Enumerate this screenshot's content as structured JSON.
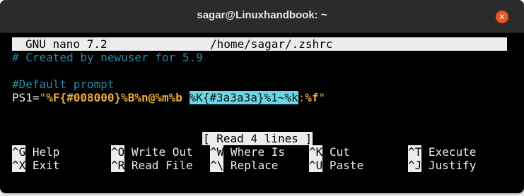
{
  "window": {
    "title": "sagar@Linuxhandbook: ~",
    "close_glyph": "✕",
    "accent": "#e9541f"
  },
  "nano": {
    "version": "GNU nano 7.2",
    "file": "/home/sagar/.zshrc"
  },
  "editor": {
    "line1": "# Created by newuser for 5.9",
    "line3": "#Default prompt",
    "line4": {
      "var": "PS1",
      "eq": "=",
      "quote_open": "\"",
      "segA": "%F{#008000}",
      "segB": "%B",
      "segC": "%n@%m",
      "segD": "%b ",
      "segE": "%K{#3a3a3a}",
      "segF": "%1~",
      "segG": "%k",
      "segH": ":",
      "segI": "%f",
      "quote_close": "\""
    }
  },
  "status_message": "[ Read 4 lines ]",
  "shortcuts": [
    {
      "key": "^G",
      "label": "Help"
    },
    {
      "key": "^O",
      "label": "Write Out"
    },
    {
      "key": "^W",
      "label": "Where Is"
    },
    {
      "key": "^K",
      "label": "Cut"
    },
    {
      "key": "^T",
      "label": "Execute"
    },
    {
      "key": "^X",
      "label": "Exit"
    },
    {
      "key": "^R",
      "label": "Read File"
    },
    {
      "key": "^\\",
      "label": "Replace"
    },
    {
      "key": "^U",
      "label": "Paste"
    },
    {
      "key": "^J",
      "label": "Justify"
    }
  ]
}
